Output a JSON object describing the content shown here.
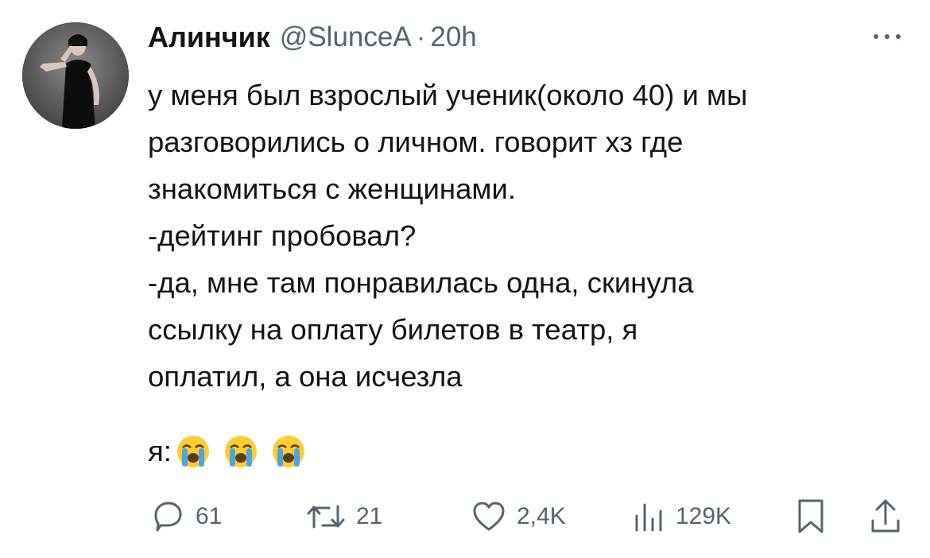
{
  "tweet": {
    "display_name": "Алинчик",
    "handle": "@SlunceA",
    "separator": "·",
    "time": "20h",
    "lines": [
      "у меня был взрослый ученик(около 40) и мы",
      "разговорились о личном. говорит хз где",
      "знакомиться с женщинами.",
      "-дейтинг пробовал?",
      "-да, мне там понравилась одна, скинула",
      "ссылку на оплату билетов в театр, я",
      "оплатил, а она исчезла"
    ],
    "reaction_label": "я:",
    "reaction_emojis": [
      "loudly-crying-face",
      "loudly-crying-face",
      "loudly-crying-face"
    ]
  },
  "actions": {
    "replies": "61",
    "retweets": "21",
    "likes": "2,4K",
    "views": "129K"
  },
  "icons": {
    "reply": "speech-bubble-icon",
    "retweet": "retweet-arrows-icon",
    "like": "heart-icon",
    "views": "bar-chart-icon",
    "bookmark": "bookmark-icon",
    "share": "share-upload-icon",
    "more": "more-dots-icon"
  },
  "colors": {
    "text_primary": "#0f1419",
    "text_secondary": "#536471",
    "emoji_yellow": "#ffcc33",
    "emoji_tear": "#4fa3e3"
  }
}
